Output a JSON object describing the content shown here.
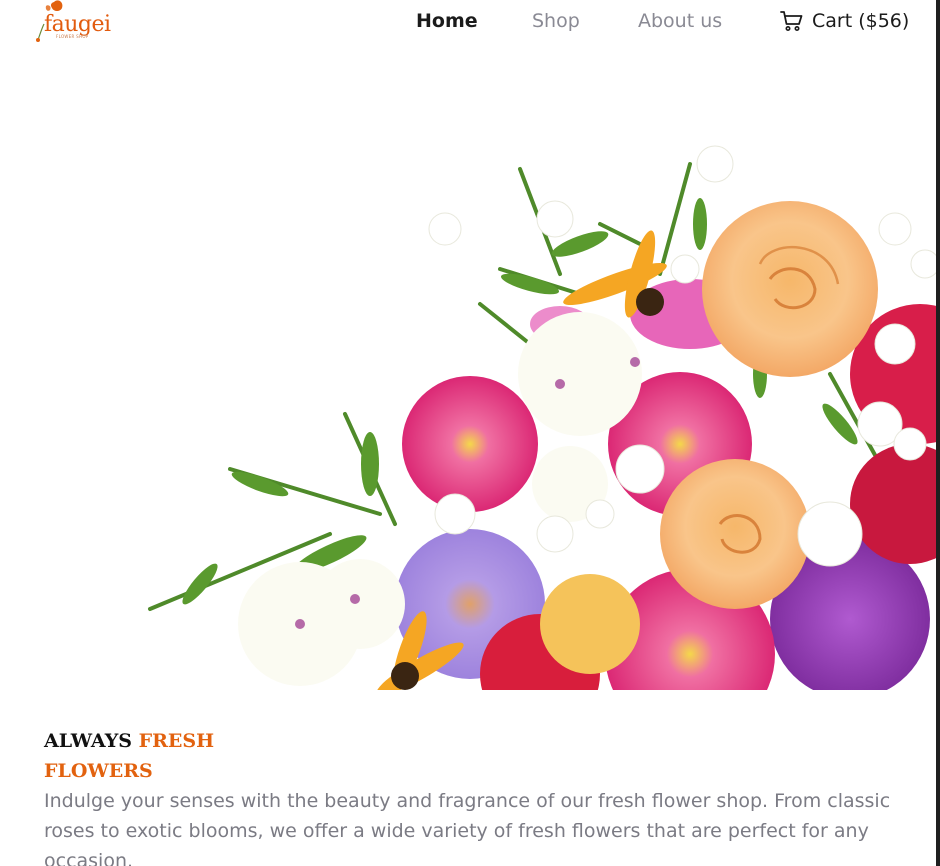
{
  "brand": {
    "name": "faugei",
    "tagline": "FLOWER SHOP",
    "accent_color": "#e2620f"
  },
  "nav": {
    "items": [
      {
        "label": "Home",
        "active": true
      },
      {
        "label": "Shop",
        "active": false
      },
      {
        "label": "About us",
        "active": false
      }
    ],
    "cart_label": "Cart ($56)",
    "cart_icon": "shopping-cart-icon"
  },
  "hero": {
    "image": "flower-bouquet"
  },
  "intro": {
    "headline_part1": "ALWAYS ",
    "headline_part2": "FRESH",
    "headline_part3": "FLOWERS",
    "description": "Indulge your senses with the beauty and fragrance of our fresh flower shop. From classic roses to exotic blooms, we offer a wide variety of fresh flowers that are perfect for any occasion."
  }
}
